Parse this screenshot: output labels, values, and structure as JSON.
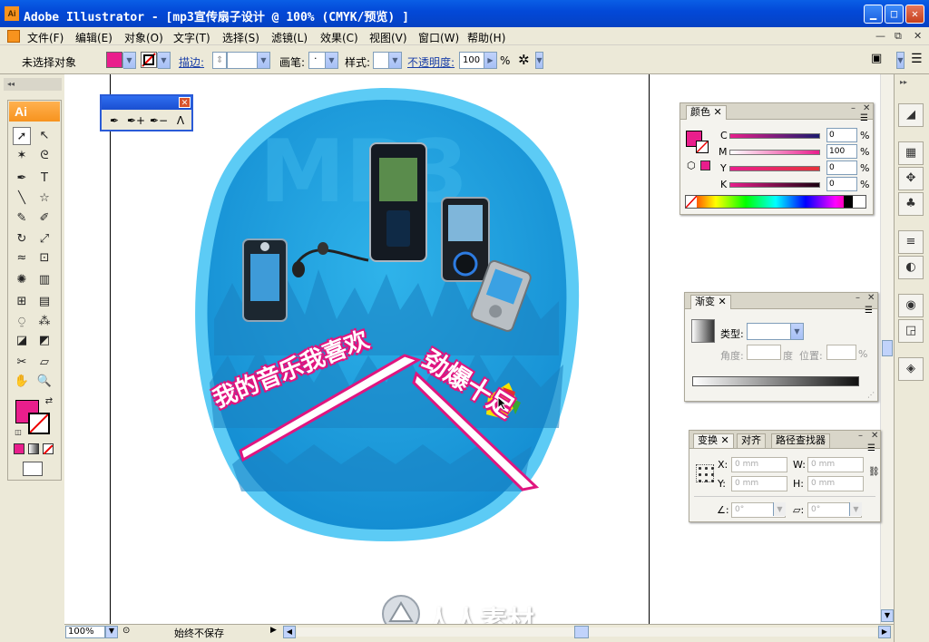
{
  "window": {
    "title": "Adobe Illustrator - [mp3宣传扇子设计 @ 100% (CMYK/预览) ]",
    "app_icon": "Ai",
    "minimize": "▁",
    "maximize": "□",
    "close": "✕"
  },
  "menu": {
    "items": [
      "文件(F)",
      "编辑(E)",
      "对象(O)",
      "文字(T)",
      "选择(S)",
      "滤镜(L)",
      "效果(C)",
      "视图(V)",
      "窗口(W)",
      "帮助(H)"
    ],
    "doc_controls": [
      "—",
      "⧉",
      "✕"
    ]
  },
  "control_bar": {
    "selection_label": "未选择对象",
    "fill_color": "#e91e8c",
    "stroke_label": "描边:",
    "brush_label": "画笔:",
    "brush_value": "·",
    "style_label": "样式:",
    "opacity_label": "不透明度:",
    "opacity_value": "100",
    "opacity_unit": "%"
  },
  "tools": {
    "header": "Ai",
    "grip": "◂◂",
    "icons": [
      "selection-icon",
      "direct-select-icon",
      "magic-wand-icon",
      "lasso-icon",
      "pen-icon",
      "type-icon",
      "line-icon",
      "star-icon",
      "paintbrush-icon",
      "pencil-icon",
      "rotate-icon",
      "scale-icon",
      "warp-icon",
      "free-transform-icon",
      "symbol-sprayer-icon",
      "graph-icon",
      "mesh-icon",
      "gradient-icon",
      "eyedropper-icon",
      "blend-icon",
      "live-paint-icon",
      "live-paint-select-icon",
      "slice-icon",
      "eraser-icon",
      "hand-icon",
      "zoom-icon"
    ],
    "glyphs": [
      "➚",
      "↖",
      "✶",
      "ᘓ",
      "✒",
      "T",
      "╲",
      "☆",
      "✎",
      "✐",
      "↻",
      "⤢",
      "≈",
      "⊡",
      "✺",
      "▥",
      "⊞",
      "▤",
      "⍜",
      "⁂",
      "◪",
      "◩",
      "✂",
      "▱",
      "✋",
      "🔍"
    ],
    "fill_color": "#e91e8c"
  },
  "pen_palette": {
    "tools": [
      "✒",
      "✒+",
      "✒−",
      "ᐱ"
    ]
  },
  "artwork": {
    "slogan_left": "我的音乐我喜欢",
    "slogan_right": "劲爆十足",
    "bg_text": "MP3",
    "fan_color": "#1eaaea"
  },
  "watermark": {
    "text": "人人素材"
  },
  "status": {
    "zoom": "100%",
    "save_state": "始终不保存"
  },
  "color_panel": {
    "tab": "颜色",
    "channels": [
      {
        "name": "C",
        "value": "0"
      },
      {
        "name": "M",
        "value": "100"
      },
      {
        "name": "Y",
        "value": "0"
      },
      {
        "name": "K",
        "value": "0"
      }
    ],
    "unit": "%",
    "swatch": "#e91e8c"
  },
  "gradient_panel": {
    "tab": "渐变",
    "type_label": "类型:",
    "angle_label": "角度:",
    "angle_unit": "度",
    "position_label": "位置:",
    "position_unit": "%"
  },
  "transform_panel": {
    "tabs": [
      "变换",
      "对齐",
      "路径查找器"
    ],
    "x_label": "X:",
    "y_label": "Y:",
    "w_label": "W:",
    "h_label": "H:",
    "x_value": "0 mm",
    "y_value": "0 mm",
    "w_value": "0 mm",
    "h_value": "0 mm",
    "rotate_value": "0°",
    "shear_value": "0°"
  }
}
